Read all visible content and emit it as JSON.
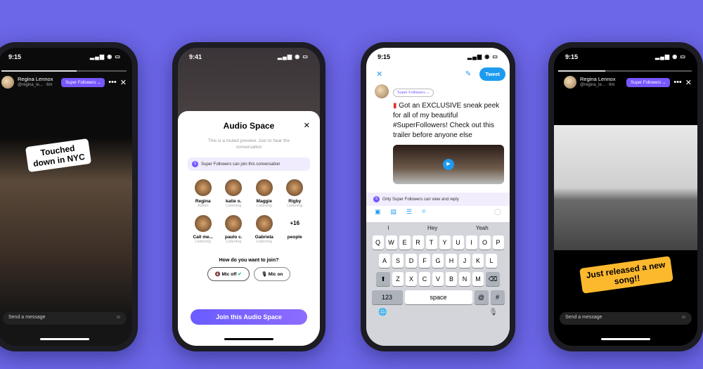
{
  "story1": {
    "time": "9:15",
    "name": "Regina Lennox",
    "handle": "@regina_le... · 6m",
    "audience": "Super Followers",
    "sticker": "Touched down in NYC",
    "message_placeholder": "Send a message",
    "progress": 0.6
  },
  "space": {
    "time": "9:41",
    "title": "Audio Space",
    "subtitle": "This is a muted preview. Join to hear the conversation",
    "banner": "Super Followers can join this conversation",
    "people": [
      {
        "name": "Regina",
        "role": "Admin"
      },
      {
        "name": "katie o.",
        "role": "Listening"
      },
      {
        "name": "Maggie",
        "role": "Listening"
      },
      {
        "name": "Rigby",
        "role": "Listening"
      },
      {
        "name": "Call me...",
        "role": "Listening"
      },
      {
        "name": "paulo c.",
        "role": "Listening"
      },
      {
        "name": "Gabriela",
        "role": "Listening"
      }
    ],
    "more_count": "+16",
    "more_label": "people",
    "question": "How do you want to join?",
    "mic_off": "Mic off",
    "mic_on": "Mic on",
    "join": "Join this Audio Space"
  },
  "compose": {
    "time": "9:15",
    "tweet_button": "Tweet",
    "audience": "Super Followers",
    "text": "Got an EXCLUSIVE sneak peek for all of my beautiful #SuperFollowers! Check out this trailer before anyone else",
    "notice": "Only Super Followers can view and reply",
    "suggestions": [
      "I",
      "Hey",
      "Yeah"
    ],
    "rows": [
      [
        "Q",
        "W",
        "E",
        "R",
        "T",
        "Y",
        "U",
        "I",
        "O",
        "P"
      ],
      [
        "A",
        "S",
        "D",
        "F",
        "G",
        "H",
        "J",
        "K",
        "L"
      ],
      [
        "Z",
        "X",
        "C",
        "V",
        "B",
        "N",
        "M"
      ]
    ],
    "num": "123",
    "space": "space",
    "at": "@",
    "hash": "#"
  },
  "story2": {
    "time": "9:15",
    "name": "Regina Lennox",
    "handle": "@regina_le... · 6m",
    "audience": "Super Followers",
    "sticker": "Just released a new song!!",
    "message_placeholder": "Send a message",
    "progress": 0.35
  },
  "colors": {
    "background": "#6c66e8",
    "accent": "#7856ff",
    "twitter_blue": "#1d9bf0"
  }
}
